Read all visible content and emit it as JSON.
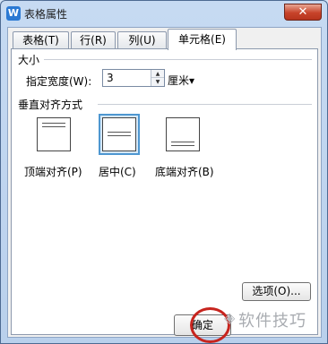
{
  "window": {
    "title": "表格属性",
    "app_icon": "W",
    "close_symbol": "✕"
  },
  "tabs": [
    {
      "label": "表格(T)",
      "active": false
    },
    {
      "label": "行(R)",
      "active": false
    },
    {
      "label": "列(U)",
      "active": false
    },
    {
      "label": "单元格(E)",
      "active": true
    }
  ],
  "size_group": {
    "title": "大小",
    "width_label": "指定宽度(W):",
    "width_value": "3",
    "unit": "厘米▾"
  },
  "valign_group": {
    "title": "垂直对齐方式",
    "options": [
      {
        "label": "顶端对齐(P)",
        "selected": false
      },
      {
        "label": "居中(C)",
        "selected": true
      },
      {
        "label": "底端对齐(B)",
        "selected": false
      }
    ]
  },
  "buttons": {
    "options": "选项(O)...",
    "ok": "确定"
  },
  "watermark": {
    "text": "软件技巧"
  },
  "colors": {
    "window_frame": "#c6daf2",
    "close_button": "#c7432a",
    "selected_option": "#4e97d1",
    "highlight_circle": "#c7241e"
  }
}
